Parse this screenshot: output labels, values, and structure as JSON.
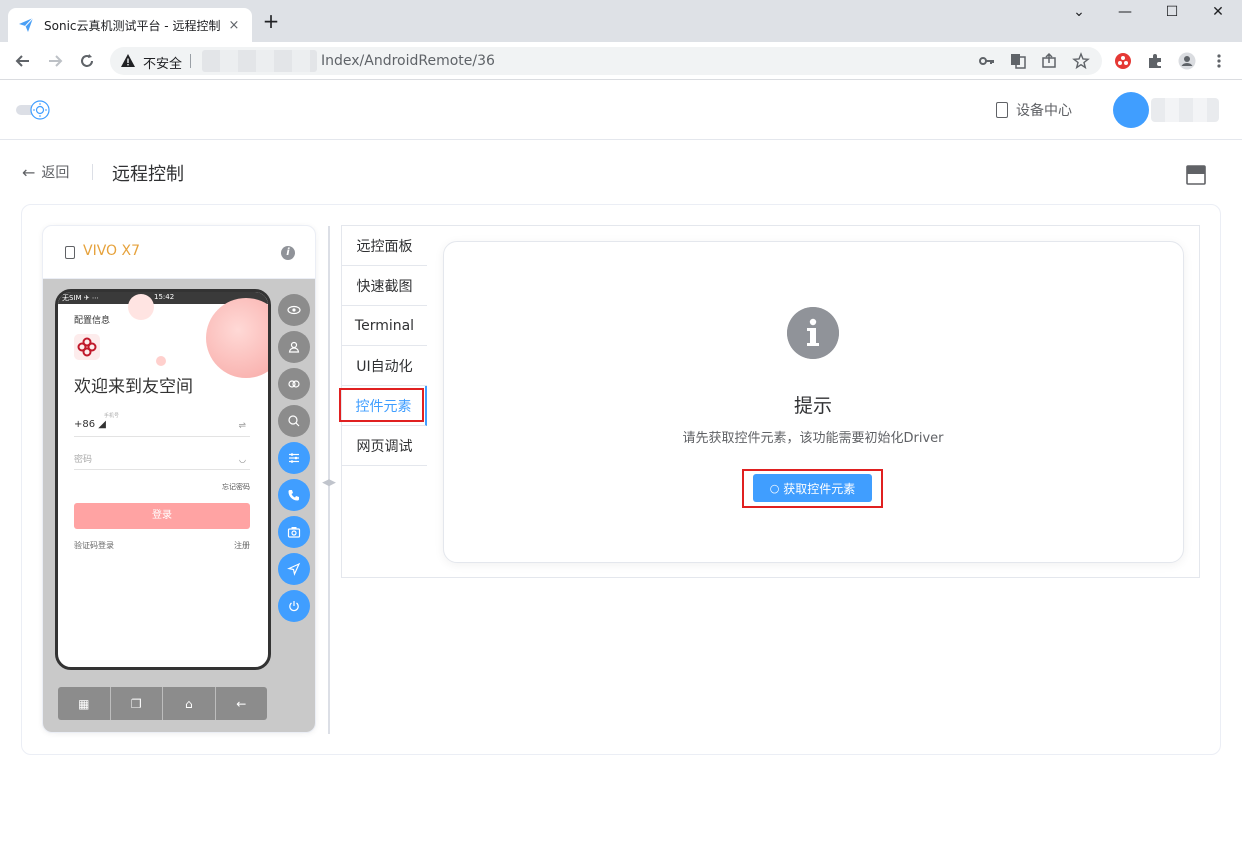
{
  "browser": {
    "tab_title": "Sonic云真机测试平台 - 远程控制",
    "tab_close": "×",
    "new_tab": "+",
    "insecure_label": "不安全",
    "url": "Index/AndroidRemote/36",
    "win_min": "⌄",
    "win_restore": "—",
    "win_max": "☐",
    "win_close": "✕"
  },
  "header": {
    "device_center": "设备中心"
  },
  "page": {
    "back_label": "返回",
    "title": "远程控制"
  },
  "device": {
    "name": "VIVO X7",
    "info_glyph": "i",
    "screen": {
      "status_left": "无SIM  ✈ ⋯",
      "status_time": "15:42",
      "config_text": "配置信息",
      "welcome": "欢迎来到友空间",
      "phone_label": "手机号",
      "country_code": "+86 ◢",
      "switch_glyph": "⇌",
      "password_placeholder": "密码",
      "eye_glyph": "◡",
      "forgot": "忘记密码",
      "login": "登录",
      "sms_login": "验证码登录",
      "register": "注册"
    },
    "nav": {
      "menu_glyph": "▦",
      "recent_glyph": "❐",
      "home_glyph": "⌂",
      "back_glyph": "←"
    }
  },
  "tabs": [
    {
      "label": "远控面板"
    },
    {
      "label": "快速截图"
    },
    {
      "label": "Terminal"
    },
    {
      "label": "UI自动化"
    },
    {
      "label": "控件元素"
    },
    {
      "label": "网页调试"
    }
  ],
  "hint": {
    "title": "提示",
    "description": "请先获取控件元素，该功能需要初始化Driver",
    "button_label": "获取控件元素"
  },
  "colors": {
    "primary": "#409eff",
    "device_name": "#e6a23c",
    "highlight": "#e02020"
  }
}
